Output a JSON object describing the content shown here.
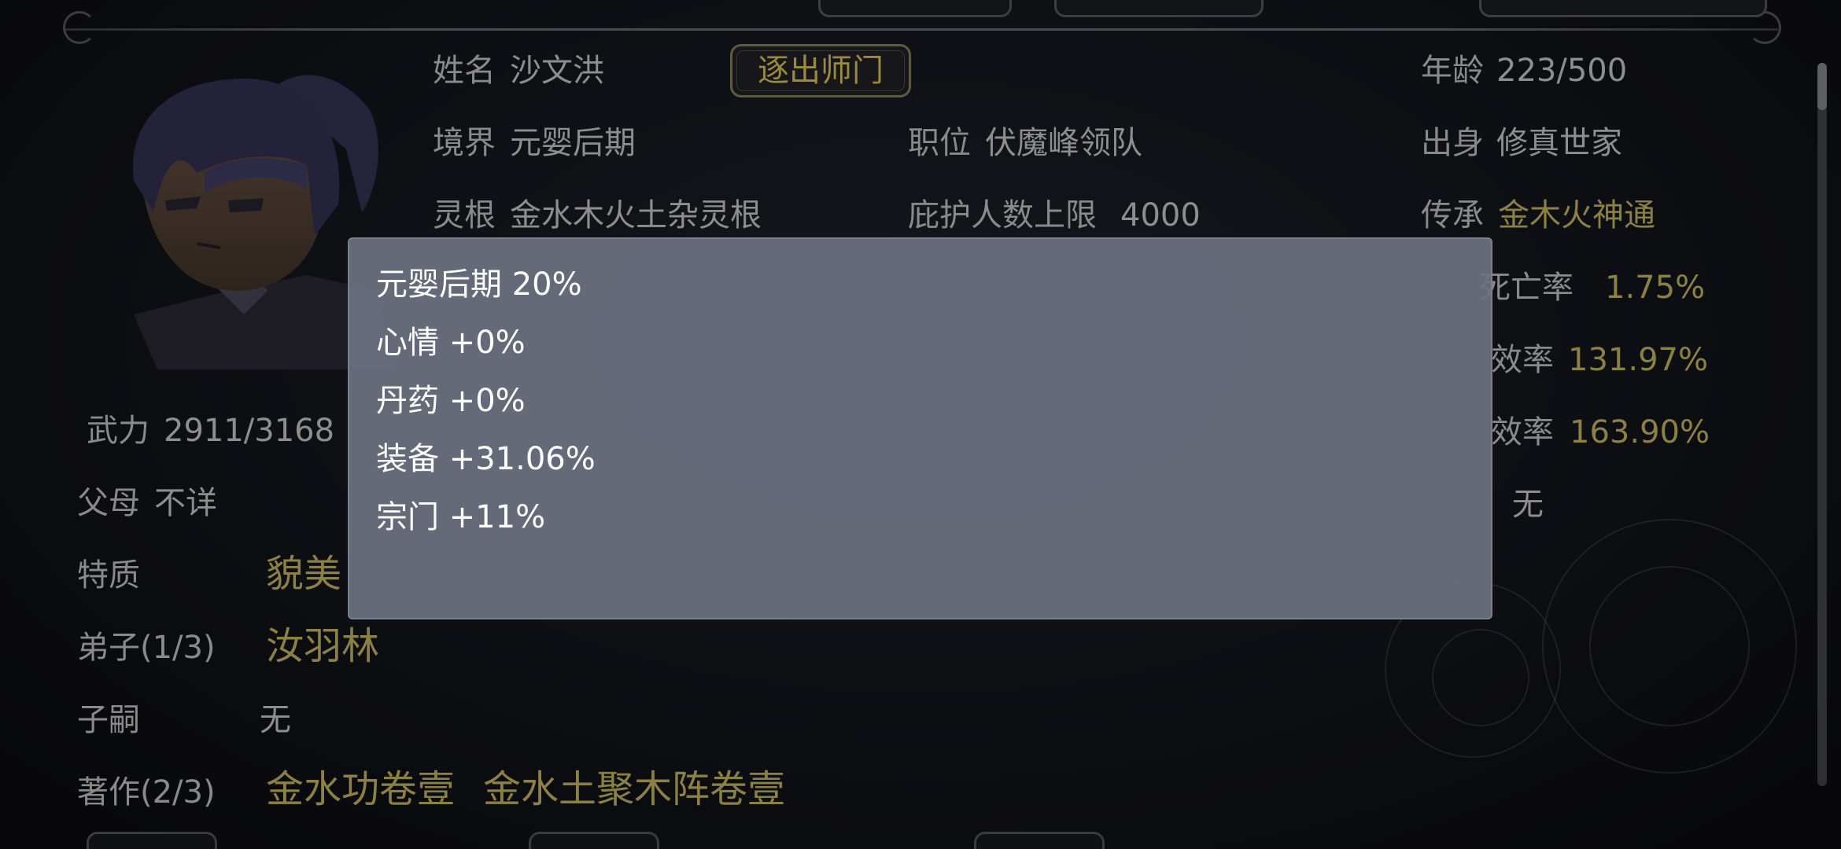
{
  "header": {
    "name_label": "姓名",
    "name_value": "沙文洪",
    "expel_button": "逐出师门",
    "age_label": "年龄",
    "age_value": "223/500"
  },
  "info": {
    "realm_label": "境界",
    "realm_value": "元婴后期",
    "position_label": "职位",
    "position_value": "伏魔峰领队",
    "origin_label": "出身",
    "origin_value": "修真世家",
    "root_label": "灵根",
    "root_value": "金水木火土杂灵根",
    "protect_label": "庇护人数上限",
    "protect_value": "4000",
    "inherit_label": "传承",
    "inherit_value": "金木火神通",
    "death_label": "死亡率",
    "death_value": "1.75%",
    "eff1_label": "效率",
    "eff1_value": "131.97%",
    "eff2_label": "效率",
    "eff2_value": "163.90%",
    "dao_value": "无"
  },
  "stats": {
    "force_label": "武力",
    "force_value": "2911/3168",
    "parents_label": "父母",
    "parents_value": "不详",
    "trait_label": "特质",
    "trait_value": "貌美",
    "disciples_label": "弟子(1/3)",
    "disciples_value": "汝羽林",
    "children_label": "子嗣",
    "children_value": "无",
    "works_label": "著作(2/3)",
    "work_1": "金水功卷壹",
    "work_2": "金水土聚木阵卷壹"
  },
  "tooltip": {
    "rows": [
      "元婴后期 20%",
      "心情 +0%",
      "丹药 +0%",
      "装备 +31.06%",
      "宗门 +11%"
    ]
  },
  "colors": {
    "gold": "#8c8144",
    "tooltip_bg": "#6c7282"
  }
}
